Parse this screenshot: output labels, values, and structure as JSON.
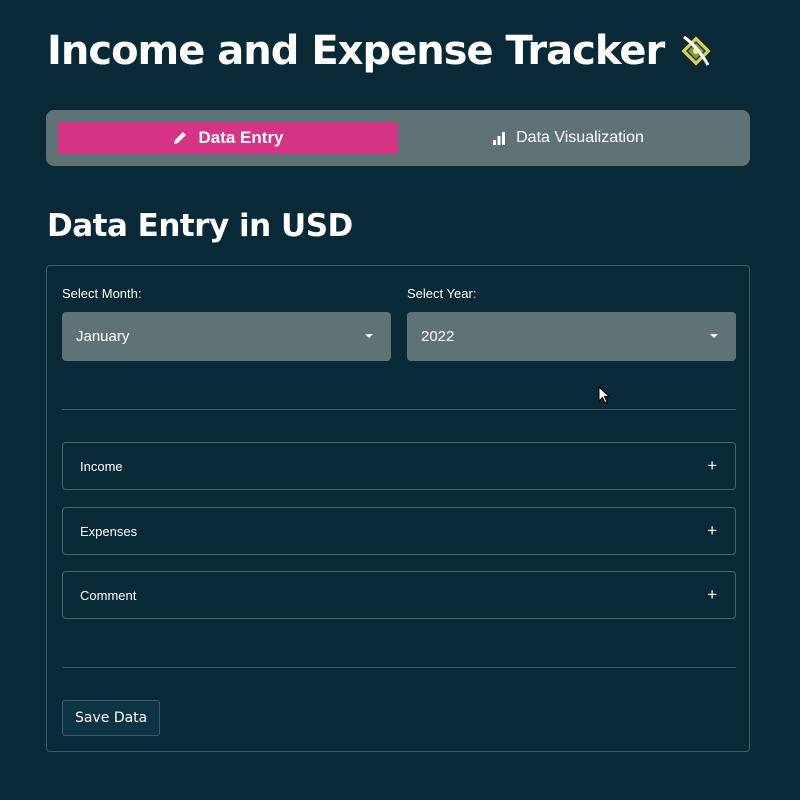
{
  "header": {
    "title": "Income and Expense Tracker",
    "logo_icon": "money-stack-icon"
  },
  "tabs": [
    {
      "label": "Data Entry",
      "icon": "pencil-icon",
      "active": true
    },
    {
      "label": "Data Visualization",
      "icon": "bar-chart-icon",
      "active": false
    }
  ],
  "section": {
    "title": "Data Entry in USD"
  },
  "form": {
    "month_label": "Select Month:",
    "month_value": "January",
    "year_label": "Select Year:",
    "year_value": "2022",
    "accordions": [
      "Income",
      "Expenses",
      "Comment"
    ],
    "save_label": "Save Data"
  },
  "colors": {
    "background": "#0a2936",
    "accent": "#d63384",
    "control": "#5f7377"
  }
}
